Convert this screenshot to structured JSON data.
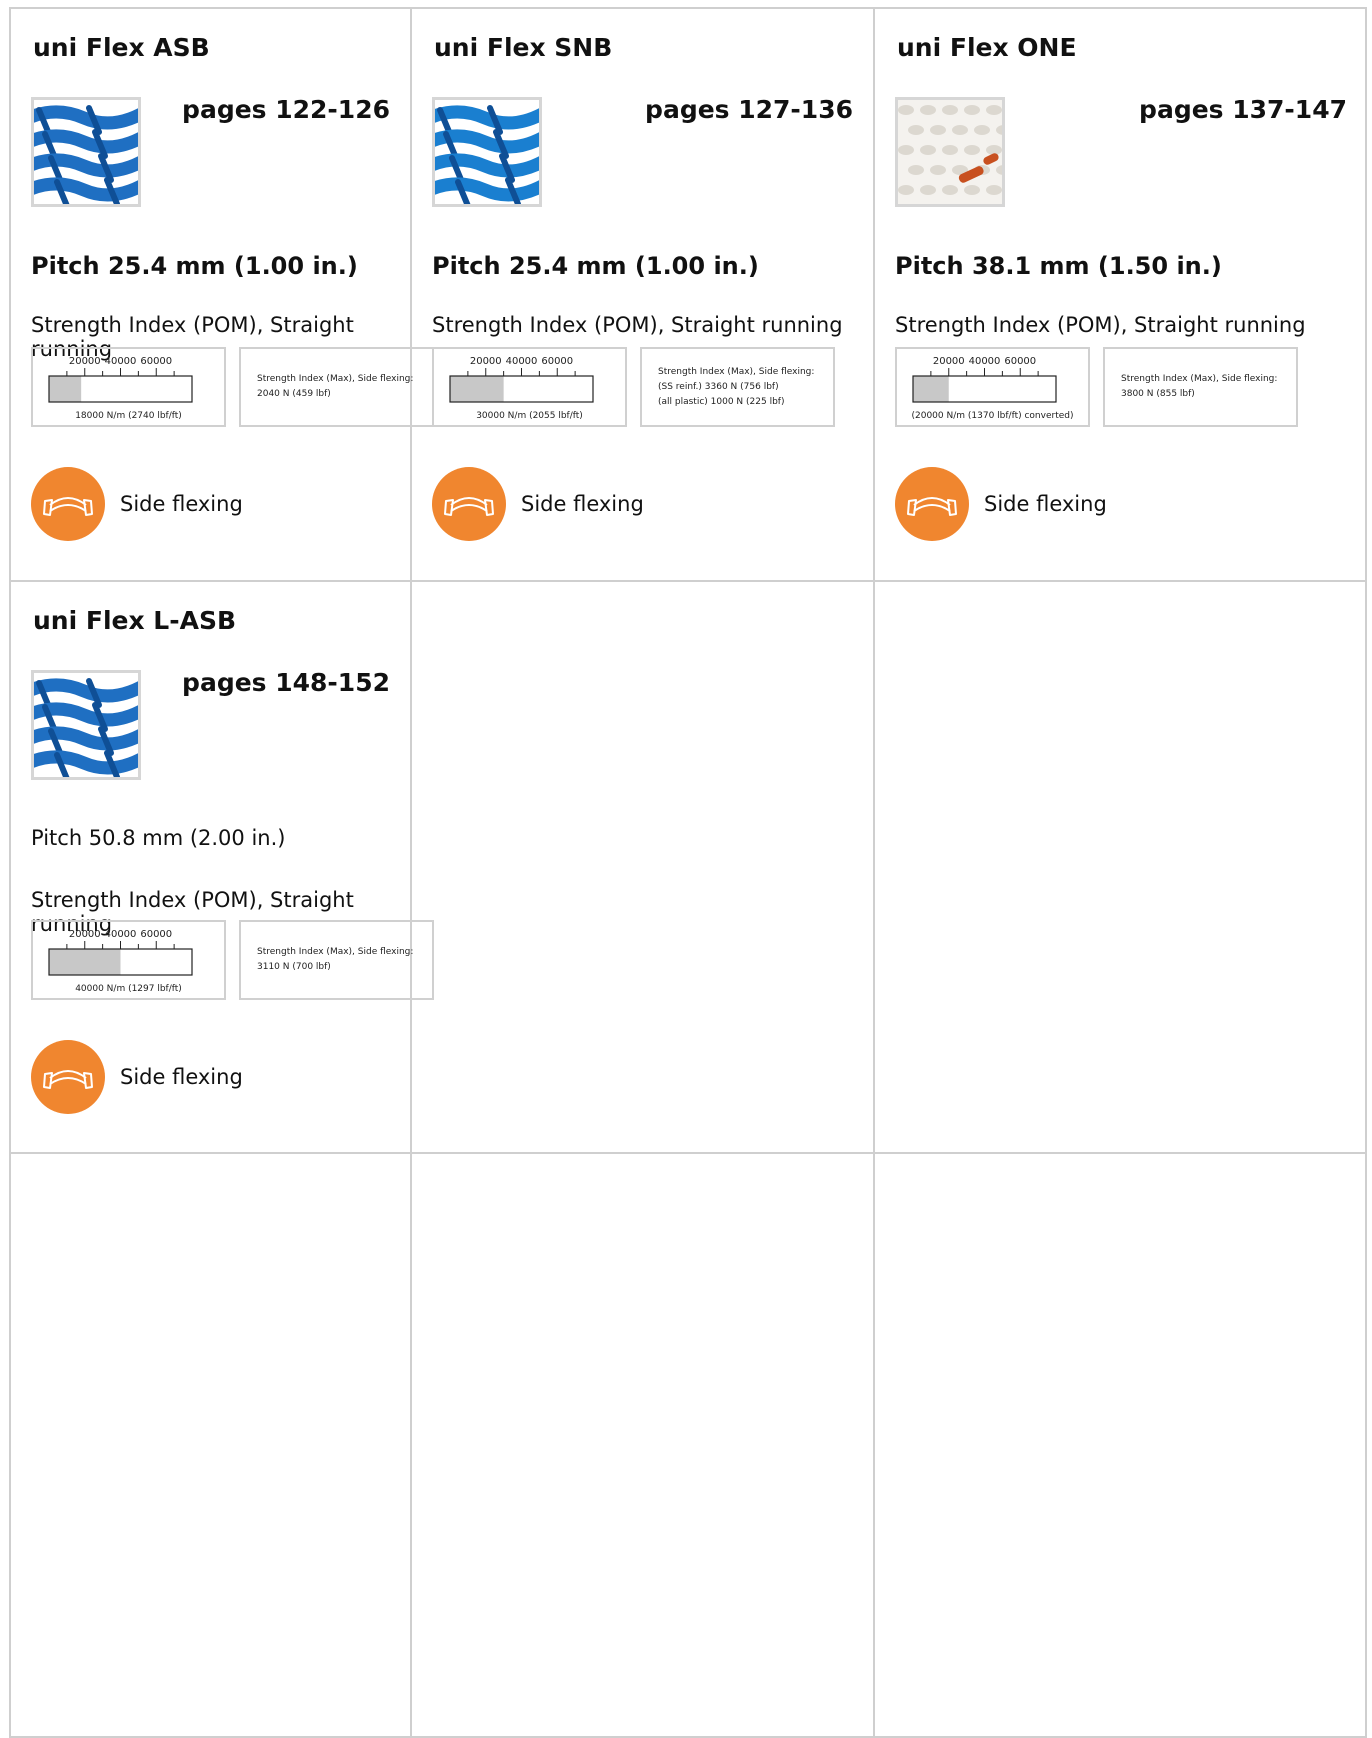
{
  "products": [
    {
      "name": "uni Flex ASB",
      "pages": "pages 122-126",
      "pitch": "Pitch 25.4 mm (1.00 in.)",
      "pitch_bold": true,
      "strength_label": "Strength Index (POM), Straight running",
      "scale_ticks": [
        "20000",
        "40000",
        "60000"
      ],
      "strength_value": 18000,
      "scale_caption": "18000 N/m (2740 lbf/ft)",
      "max_lines": [
        "Strength Index (Max), Side flexing:",
        "2040 N (459 lbf)"
      ],
      "feature": "Side flexing",
      "feature_icon": "side-flex-arrows-icon",
      "thumb_color": "#1f6fc2"
    },
    {
      "name": "uni Flex SNB",
      "pages": "pages 127-136",
      "pitch": "Pitch 25.4 mm (1.00 in.)",
      "pitch_bold": true,
      "strength_label": "Strength Index (POM), Straight running",
      "scale_ticks": [
        "20000",
        "40000",
        "60000"
      ],
      "strength_value": 30000,
      "scale_caption": "30000 N/m (2055 lbf/ft)",
      "max_lines": [
        "Strength Index (Max), Side flexing:",
        "(SS reinf.) 3360 N (756 lbf)",
        "(all plastic) 1000 N (225 lbf)"
      ],
      "feature": "Side flexing",
      "feature_icon": "side-flex-arrows-icon",
      "thumb_color": "#1a7fd0"
    },
    {
      "name": "uni Flex ONE",
      "pages": "pages 137-147",
      "pitch": "Pitch 38.1 mm (1.50 in.)",
      "pitch_bold": true,
      "strength_label": "Strength Index (POM), Straight running",
      "scale_ticks": [
        "20000",
        "40000",
        "60000"
      ],
      "strength_value": 20000,
      "scale_caption": "(20000 N/m (1370 lbf/ft) converted)",
      "max_lines": [
        "Strength Index (Max), Side flexing:",
        "3800 N (855 lbf)"
      ],
      "feature": "Side flexing",
      "feature_icon": "side-flex-arrows-icon",
      "thumb_color": "#e8e4de"
    },
    {
      "name": "uni Flex L-ASB",
      "pages": "pages 148-152",
      "pitch": "Pitch 50.8 mm (2.00 in.)",
      "pitch_bold": false,
      "strength_label": "Strength Index (POM), Straight running",
      "scale_ticks": [
        "20000",
        "40000",
        "60000"
      ],
      "strength_value": 40000,
      "scale_caption": "40000 N/m (1297 lbf/ft)",
      "max_lines": [
        "Strength Index (Max), Side flexing:",
        "3110 N (700 lbf)"
      ],
      "feature": "Side flexing",
      "feature_icon": "side-flex-arrows-icon",
      "thumb_color": "#1f6fc2"
    }
  ],
  "scale_max": 80000,
  "colors": {
    "accent": "#f0862f",
    "bar_fill": "#c8c8c8",
    "border": "#cfcfcf"
  }
}
